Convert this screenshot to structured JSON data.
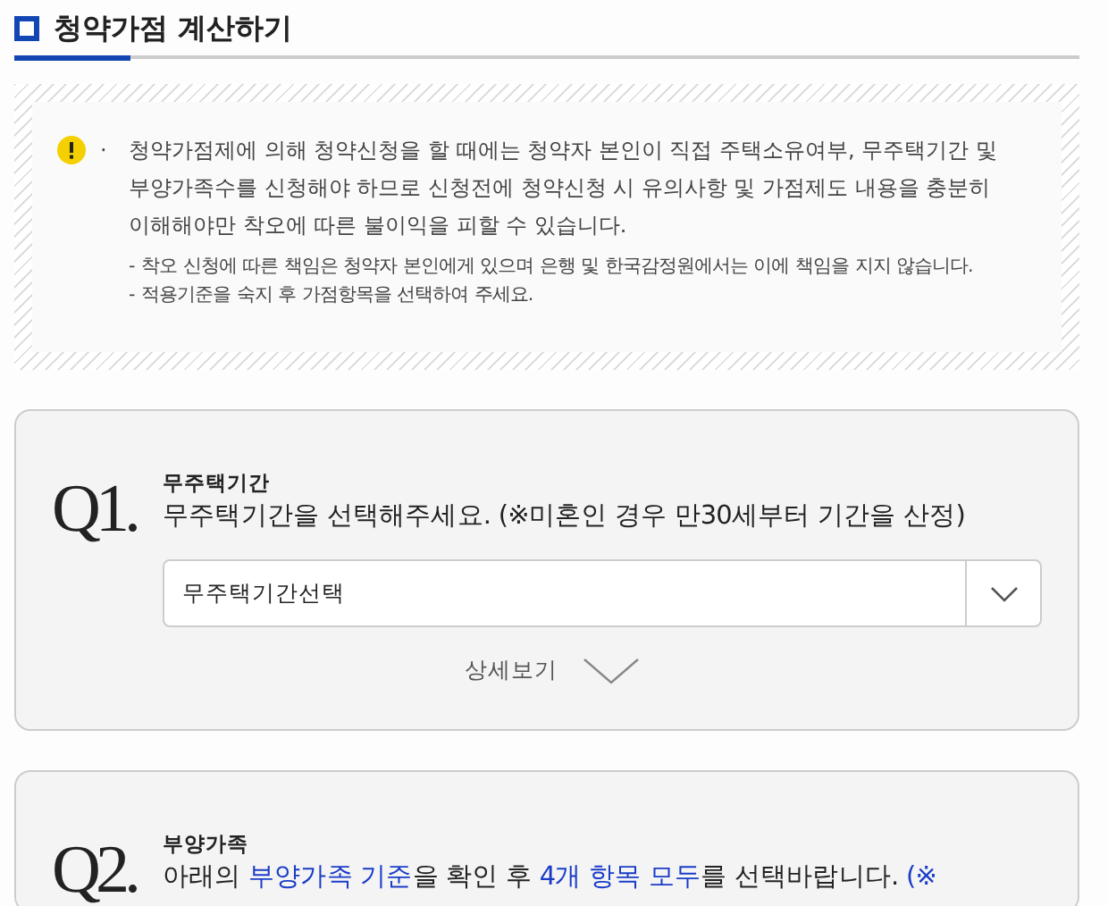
{
  "page_title": "청약가점 계산하기",
  "notice": {
    "bullet": "·",
    "main": "청약가점제에 의해 청약신청을 할 때에는 청약자 본인이 직접 주택소유여부, 무주택기간 및 부양가족수를 신청해야 하므로 신청전에 청약신청 시 유의사항 및 가점제도 내용을 충분히 이해해야만 착오에 따른 불이익을 피할 수 있습니다.",
    "notes": [
      "- 착오 신청에 따른 책임은 청약자 본인에게 있으며 은행 및 한국감정원에서는 이에 책임을 지지 않습니다.",
      "- 적용기준을 숙지 후 가점항목을 선택하여 주세요."
    ]
  },
  "questions": [
    {
      "number": "Q1.",
      "label": "무주택기간",
      "prompt": [
        {
          "text": "무주택기간을 선택해주세요. (※미혼인 경우 만30세부터 기간을 산정)",
          "highlight": false
        }
      ],
      "select": {
        "value": "무주택기간선택"
      },
      "details_link": "상세보기"
    },
    {
      "number": "Q2.",
      "label": "부양가족",
      "prompt": [
        {
          "text": "아래의 ",
          "highlight": false
        },
        {
          "text": "부양가족 기준",
          "highlight": true
        },
        {
          "text": "을 확인 후 ",
          "highlight": false
        },
        {
          "text": "4개 항목 모두",
          "highlight": true
        },
        {
          "text": "를 선택바랍니다. ",
          "highlight": false
        },
        {
          "text": "(※",
          "highlight": true
        }
      ]
    }
  ]
}
